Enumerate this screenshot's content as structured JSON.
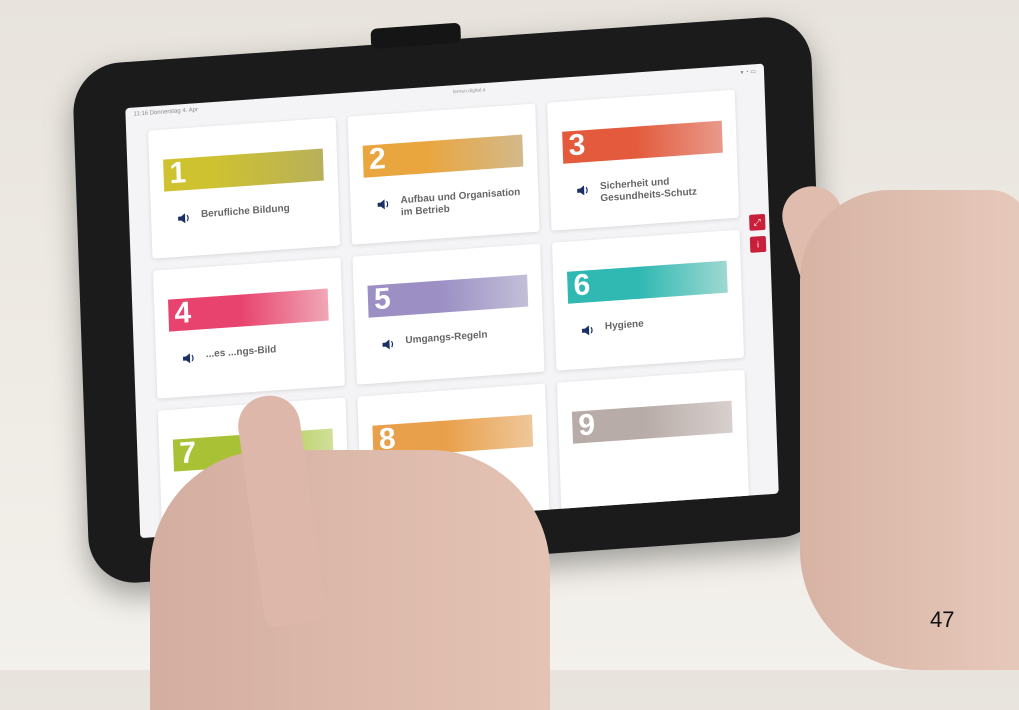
{
  "page_number": "47",
  "status_bar": {
    "time_date": "11:16  Donnerstag 4. Apr",
    "url": "lernen.digital.a"
  },
  "tiles": [
    {
      "number": "1",
      "label": "Berufliche Bildung",
      "color": "#cfc230"
    },
    {
      "number": "2",
      "label": "Aufbau und Organisation im Betrieb",
      "color": "#e9a63f"
    },
    {
      "number": "3",
      "label": "Sicherheit und Gesundheits-Schutz",
      "color": "#e35a3c"
    },
    {
      "number": "4",
      "label": "...es ...ngs-Bild",
      "color": "#e8436e"
    },
    {
      "number": "5",
      "label": "Umgangs-Regeln",
      "color": "#9b8fc4"
    },
    {
      "number": "6",
      "label": "Hygiene",
      "color": "#2fb9b2"
    },
    {
      "number": "7",
      "label": "",
      "color": "#a9c235"
    },
    {
      "number": "8",
      "label": "",
      "color": "#e9a04a"
    },
    {
      "number": "9",
      "label": "",
      "color": "#b8aca8"
    }
  ],
  "side_buttons": [
    {
      "icon": "expand-icon",
      "glyph": "⤢"
    },
    {
      "icon": "info-icon",
      "glyph": "i"
    }
  ]
}
